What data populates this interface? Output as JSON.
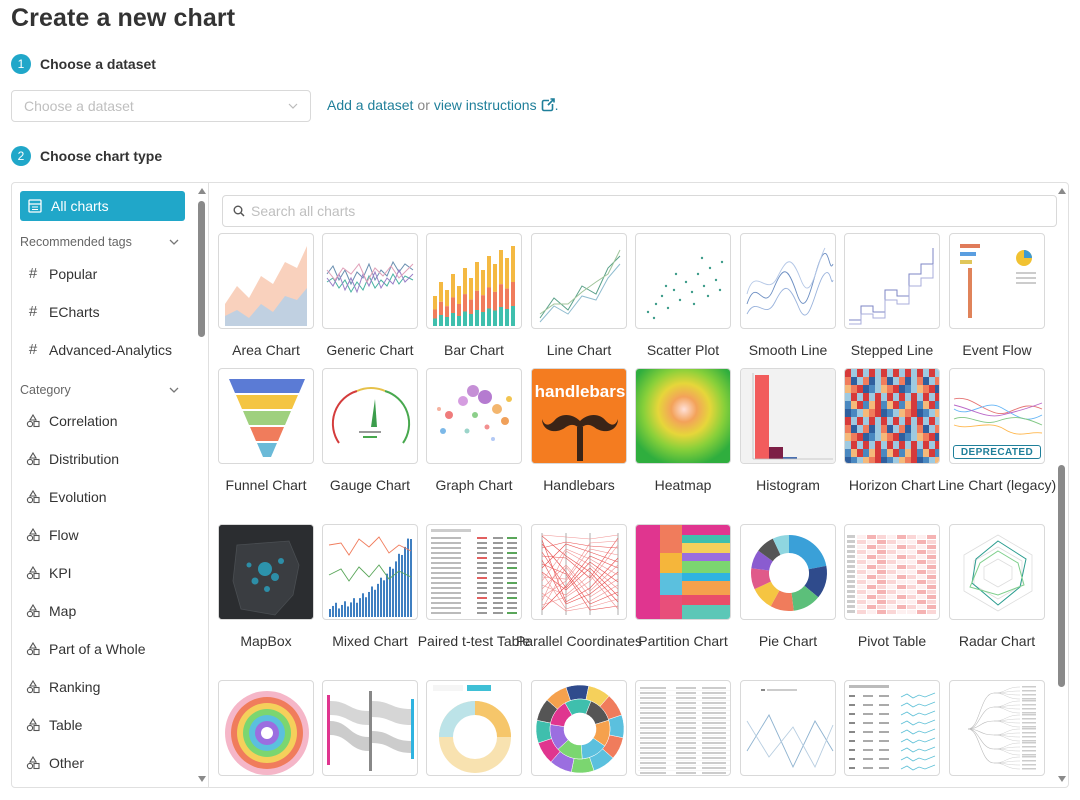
{
  "page": {
    "title": "Create a new chart"
  },
  "steps": [
    {
      "num": "1",
      "label": "Choose a dataset"
    },
    {
      "num": "2",
      "label": "Choose chart type"
    }
  ],
  "dataset": {
    "placeholder": "Choose a dataset",
    "add_link": "Add a dataset",
    "or_text": "or",
    "instructions_link": "view instructions",
    "trailing": "."
  },
  "sidebar": {
    "all_charts": "All charts",
    "recommended_tags_title": "Recommended tags",
    "tags": [
      "Popular",
      "ECharts",
      "Advanced-Analytics"
    ],
    "category_title": "Category",
    "categories": [
      "Correlation",
      "Distribution",
      "Evolution",
      "Flow",
      "KPI",
      "Map",
      "Part of a Whole",
      "Ranking",
      "Table",
      "Other"
    ]
  },
  "search": {
    "placeholder": "Search all charts"
  },
  "charts": {
    "row1": [
      "Area Chart",
      "Generic Chart",
      "Bar Chart",
      "Line Chart",
      "Scatter Plot",
      "Smooth Line",
      "Stepped Line",
      "Event Flow"
    ],
    "row2": [
      "Funnel Chart",
      "Gauge Chart",
      "Graph Chart",
      "Handlebars",
      "Heatmap",
      "Histogram",
      "Horizon Chart",
      "Line Chart (legacy)"
    ],
    "row3": [
      "MapBox",
      "Mixed Chart",
      "Paired t-test Table",
      "Parallel Coordinates",
      "Partition Chart",
      "Pie Chart",
      "Pivot Table",
      "Radar Chart"
    ],
    "deprecated_badge": "DEPRECATED",
    "handlebars_thumb_text": "handlebars"
  },
  "colors": {
    "accent": "#20a7c9",
    "link": "#1f7f9a",
    "border": "#d9d9d9",
    "text": "#333333"
  }
}
